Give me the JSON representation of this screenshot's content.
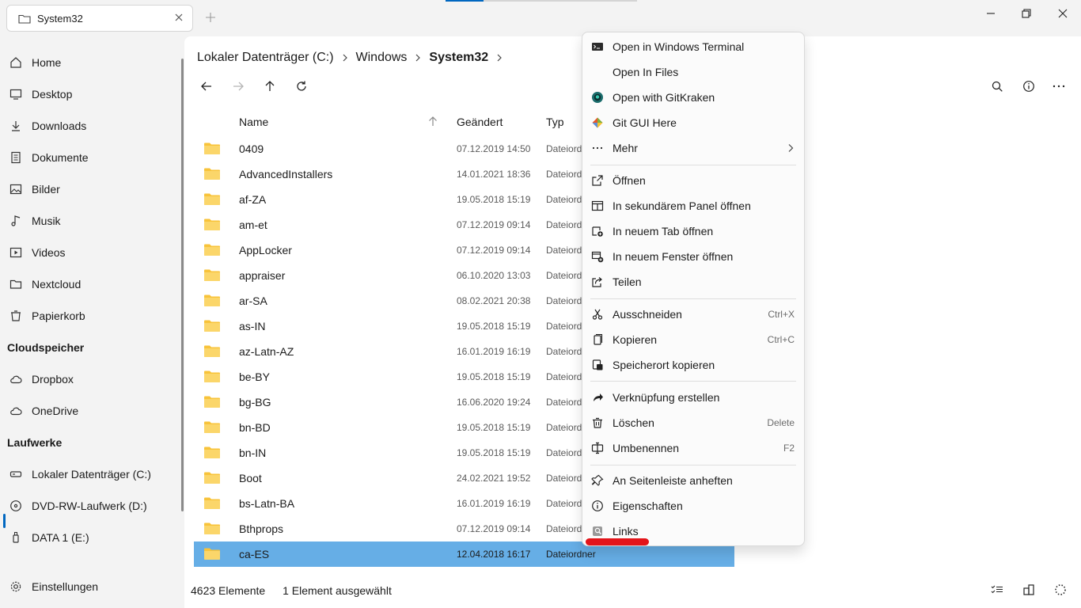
{
  "window": {
    "tab_title": "System32",
    "icons": {
      "tab": "folder-icon",
      "close": "close-icon",
      "add": "plus-icon",
      "minimize": "minimize-icon",
      "restore": "restore-icon",
      "close_window": "close-icon"
    }
  },
  "sidebar": {
    "items": [
      {
        "label": "Home",
        "icon": "home-icon"
      },
      {
        "label": "Desktop",
        "icon": "desktop-icon"
      },
      {
        "label": "Downloads",
        "icon": "download-icon"
      },
      {
        "label": "Dokumente",
        "icon": "document-icon"
      },
      {
        "label": "Bilder",
        "icon": "image-icon"
      },
      {
        "label": "Musik",
        "icon": "music-icon"
      },
      {
        "label": "Videos",
        "icon": "video-icon"
      },
      {
        "label": "Nextcloud",
        "icon": "folder-icon"
      },
      {
        "label": "Papierkorb",
        "icon": "recycle-bin-icon"
      }
    ],
    "cloud_heading": "Cloudspeicher",
    "cloud": [
      {
        "label": "Dropbox",
        "icon": "cloud-icon"
      },
      {
        "label": "OneDrive",
        "icon": "cloud-icon"
      }
    ],
    "drives_heading": "Laufwerke",
    "drives": [
      {
        "label": "Lokaler Datenträger (C:)",
        "icon": "drive-icon"
      },
      {
        "label": "DVD-RW-Laufwerk (D:)",
        "icon": "disc-icon"
      },
      {
        "label": "DATA 1 (E:)",
        "icon": "usb-drive-icon"
      }
    ],
    "settings": "Einstellungen"
  },
  "breadcrumb": [
    "Lokaler Datenträger (C:)",
    "Windows",
    "System32"
  ],
  "columns": {
    "name": "Name",
    "modified": "Geändert",
    "type": "Typ"
  },
  "files": [
    {
      "name": "0409",
      "date": "07.12.2019 14:50",
      "type": "Dateiordner"
    },
    {
      "name": "AdvancedInstallers",
      "date": "14.01.2021 18:36",
      "type": "Dateiordner"
    },
    {
      "name": "af-ZA",
      "date": "19.05.2018 15:19",
      "type": "Dateiordner"
    },
    {
      "name": "am-et",
      "date": "07.12.2019 09:14",
      "type": "Dateiordner"
    },
    {
      "name": "AppLocker",
      "date": "07.12.2019 09:14",
      "type": "Dateiordner"
    },
    {
      "name": "appraiser",
      "date": "06.10.2020 13:03",
      "type": "Dateiordner"
    },
    {
      "name": "ar-SA",
      "date": "08.02.2021 20:38",
      "type": "Dateiordner"
    },
    {
      "name": "as-IN",
      "date": "19.05.2018 15:19",
      "type": "Dateiordner"
    },
    {
      "name": "az-Latn-AZ",
      "date": "16.01.2019 16:19",
      "type": "Dateiordner"
    },
    {
      "name": "be-BY",
      "date": "19.05.2018 15:19",
      "type": "Dateiordner"
    },
    {
      "name": "bg-BG",
      "date": "16.06.2020 19:24",
      "type": "Dateiordner"
    },
    {
      "name": "bn-BD",
      "date": "19.05.2018 15:19",
      "type": "Dateiordner"
    },
    {
      "name": "bn-IN",
      "date": "19.05.2018 15:19",
      "type": "Dateiordner"
    },
    {
      "name": "Boot",
      "date": "24.02.2021 19:52",
      "type": "Dateiordner"
    },
    {
      "name": "bs-Latn-BA",
      "date": "16.01.2019 16:19",
      "type": "Dateiordner"
    },
    {
      "name": "Bthprops",
      "date": "07.12.2019 09:14",
      "type": "Dateiordner"
    },
    {
      "name": "ca-ES",
      "date": "12.04.2018 16:17",
      "type": "Dateiordner",
      "selected": true
    }
  ],
  "status": {
    "count": "4623 Elemente",
    "selection": "1 Element ausgewählt"
  },
  "context_menu": {
    "items": [
      {
        "label": "Open in Windows Terminal",
        "icon": "terminal-icon"
      },
      {
        "label": "Open In Files",
        "icon": ""
      },
      {
        "label": "Open with GitKraken",
        "icon": "gitkraken-icon"
      },
      {
        "label": "Git GUI Here",
        "icon": "git-icon"
      },
      {
        "label": "Mehr",
        "icon": "more-icon",
        "submenu": true
      },
      {
        "label": "Öffnen",
        "icon": "open-icon"
      },
      {
        "label": "In sekundärem Panel öffnen",
        "icon": "dual-pane-icon"
      },
      {
        "label": "In neuem Tab öffnen",
        "icon": "new-tab-icon"
      },
      {
        "label": "In neuem Fenster öffnen",
        "icon": "new-window-icon"
      },
      {
        "label": "Teilen",
        "icon": "share-icon"
      },
      {
        "label": "Ausschneiden",
        "icon": "cut-icon",
        "shortcut": "Ctrl+X"
      },
      {
        "label": "Kopieren",
        "icon": "copy-icon",
        "shortcut": "Ctrl+C"
      },
      {
        "label": "Speicherort kopieren",
        "icon": "copy-path-icon"
      },
      {
        "label": "Verknüpfung erstellen",
        "icon": "shortcut-icon"
      },
      {
        "label": "Löschen",
        "icon": "delete-icon",
        "shortcut": "Delete"
      },
      {
        "label": "Umbenennen",
        "icon": "rename-icon",
        "shortcut": "F2"
      },
      {
        "label": "An Seitenleiste anheften",
        "icon": "pin-icon"
      },
      {
        "label": "Eigenschaften",
        "icon": "info-icon"
      },
      {
        "label": "Links",
        "icon": "links-icon"
      }
    ]
  },
  "colors": {
    "accent": "#0067c0",
    "selection": "#66aee6",
    "folder": "#f8c33a",
    "annotation": "#e3141a"
  }
}
